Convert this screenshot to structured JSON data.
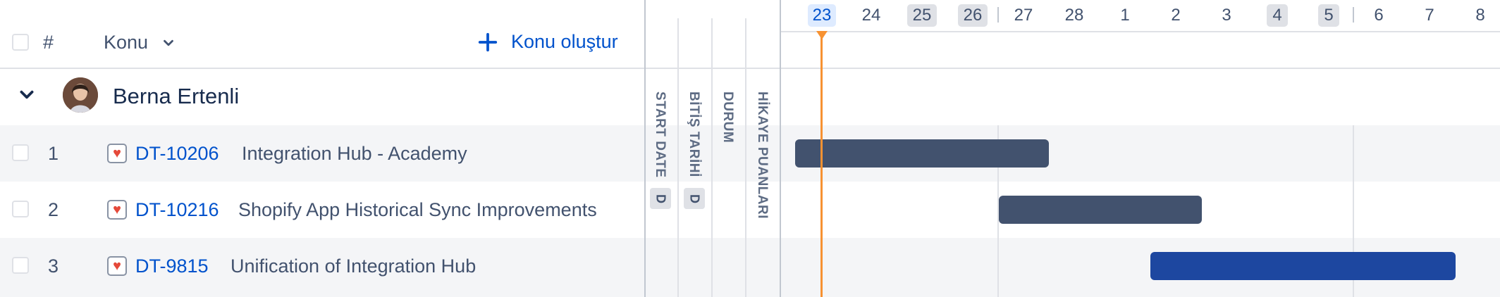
{
  "header": {
    "hash_label": "#",
    "konu_label": "Konu",
    "create_label": "Konu oluştur",
    "columns": {
      "start_date": "START DATE",
      "bitis_tarihi": "BİTİŞ TARİHİ",
      "durum": "DURUM",
      "hikaye_puanlari": "HİKAYE PUANLARI",
      "start_badge": "D",
      "bitis_badge": "D"
    }
  },
  "timeline": {
    "dates": [
      "23",
      "24",
      "25",
      "26",
      "27",
      "28",
      "1",
      "2",
      "3",
      "4",
      "5",
      "6",
      "7",
      "8"
    ],
    "today": "23",
    "shaded": [
      "25",
      "26",
      "4",
      "5"
    ]
  },
  "group": {
    "name": "Berna Ertenli"
  },
  "rows": [
    {
      "num": "1",
      "key": "DT-10206",
      "summary": "Integration Hub - Academy",
      "bar_color": "#42526e"
    },
    {
      "num": "2",
      "key": "DT-10216",
      "summary": "Shopify App Historical Sync Improvements",
      "bar_color": "#42526e"
    },
    {
      "num": "3",
      "key": "DT-9815",
      "summary": "Unification of Integration Hub",
      "bar_color": "#1d47a0"
    }
  ],
  "colors": {
    "today_line": "#f79232",
    "link": "#0052cc"
  }
}
